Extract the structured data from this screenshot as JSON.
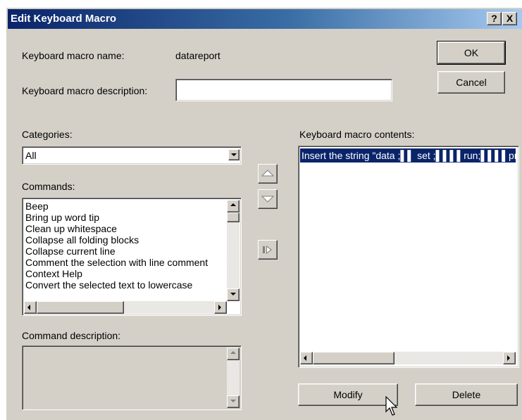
{
  "window": {
    "title": "Edit Keyboard Macro",
    "help_label": "?",
    "close_label": "X"
  },
  "macro_name": {
    "label": "Keyboard macro name:",
    "value": "datareport"
  },
  "macro_description": {
    "label": "Keyboard macro description:",
    "value": ""
  },
  "buttons": {
    "ok": "OK",
    "cancel": "Cancel",
    "modify": "Modify",
    "delete": "Delete"
  },
  "categories": {
    "label": "Categories:",
    "selected": "All"
  },
  "commands": {
    "label": "Commands:",
    "items": [
      "Beep",
      "Bring up word tip",
      "Clean up whitespace",
      "Collapse all folding blocks",
      "Collapse current line",
      "Comment the selection with line comment",
      "Context Help",
      "Convert the selected text to lowercase"
    ]
  },
  "command_description": {
    "label": "Command description:",
    "value": ""
  },
  "macro_contents": {
    "label": "Keyboard macro contents:",
    "items": [
      "Insert the string \"data ;▌▌   set ;▌▌▌▌run;▌▌▌▌proc"
    ]
  },
  "icons": {
    "move_up": "triangle-up-icon",
    "move_down": "triangle-down-icon",
    "add": "add-arrow-icon",
    "cursor": "mouse-cursor-icon"
  },
  "colors": {
    "dialog_bg": "#d4d0c8",
    "titlebar_start": "#0a246a",
    "titlebar_end": "#a6caf0",
    "selection": "#0a246a"
  }
}
